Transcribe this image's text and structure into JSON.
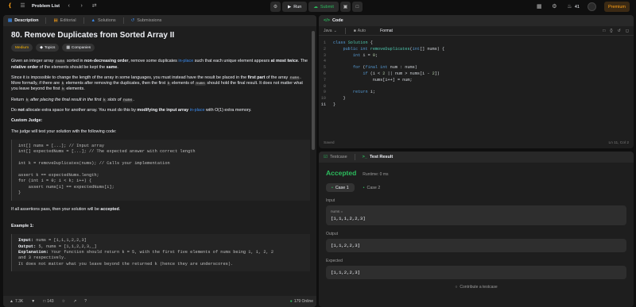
{
  "topbar": {
    "problem_list": "Problem List",
    "run": "Run",
    "submit": "Submit",
    "points": "41",
    "premium": "Premium"
  },
  "desc_tabs": [
    "Description",
    "Editorial",
    "Solutions",
    "Submissions"
  ],
  "problem": {
    "title": "80. Remove Duplicates from Sorted Array II",
    "tags": [
      "Medium",
      "Topics",
      "Companies"
    ],
    "p1_a": "Given an integer array ",
    "p1_b": "nums",
    "p1_c": " sorted in ",
    "p1_d": "non-decreasing order",
    "p1_e": ", remove some duplicates ",
    "p1_f": "in-place",
    "p1_g": " such that each unique element appears ",
    "p1_h": "at most twice",
    "p1_i": ". The ",
    "p1_j": "relative order",
    "p1_k": " of the elements should be kept the ",
    "p1_l": "same",
    "p1_m": ".",
    "p2_a": "Since it is impossible to change the length of the array in some languages, you must instead have the result be placed in the ",
    "p2_b": "first part",
    "p2_c": " of the array ",
    "p2_d": "nums",
    "p2_e": ". More formally, if there are ",
    "p2_f": "k",
    "p2_g": " elements after removing the duplicates, then the first ",
    "p2_h": "k",
    "p2_i": " elements of ",
    "p2_j": "nums",
    "p2_k": " should hold the final result. It does not matter what you leave beyond the first ",
    "p2_l": "k",
    "p2_m": " elements.",
    "p3_a": "Return ",
    "p3_b": "k",
    "p3_c": " after placing the final result in the first ",
    "p3_d": "k",
    "p3_e": " slots of ",
    "p3_f": "nums",
    "p3_g": ".",
    "p4_a": "Do ",
    "p4_b": "not",
    "p4_c": " allocate extra space for another array. You must do this by ",
    "p4_d": "modifying the input array",
    "p4_e": " in-place",
    "p4_f": " with O(1) extra memory.",
    "judge_title": "Custom Judge:",
    "judge_text": "The judge will test your solution with the following code:",
    "judge_code": "int[] nums = [...]; // Input array\nint[] expectedNums = [...]; // The expected answer with correct length\n\nint k = removeDuplicates(nums); // Calls your implementation\n\nassert k == expectedNums.length;\nfor (int i = 0; i < k; i++) {\n    assert nums[i] == expectedNums[i];\n}",
    "accept_a": "If all assertions pass, then your solution will be ",
    "accept_b": "accepted",
    "accept_c": ".",
    "example_title": "Example 1:",
    "ex_input_l": "Input:",
    "ex_input_v": " nums = [1,1,1,2,2,3]",
    "ex_output_l": "Output:",
    "ex_output_v": " 5, nums = [1,1,2,2,3,_]",
    "ex_expl_l": "Explanation:",
    "ex_expl_v": " Your function should return k = 5, with the first five elements of nums being 1, 1, 2, 2\nand 3 respectively.\nIt does not matter what you leave beyond the returned k (hence they are underscores)."
  },
  "bottom": {
    "likes": "7.3K",
    "comments": "143",
    "online": "179 Online"
  },
  "code_panel": {
    "title": "Code",
    "lang": "Java",
    "auto": "Auto",
    "format": "Format",
    "saved": "Saved",
    "cursor": "Ln 11, Col 2",
    "lines": [
      {
        "n": "1",
        "t": "class Solution {"
      },
      {
        "n": "2",
        "t": "    public int removeDuplicates(int[] nums) {"
      },
      {
        "n": "3",
        "t": "        int i = 0;"
      },
      {
        "n": "4",
        "t": ""
      },
      {
        "n": "5",
        "t": "        for (final int num : nums)"
      },
      {
        "n": "6",
        "t": "            if (i < 2 || num > nums[i - 2])"
      },
      {
        "n": "7",
        "t": "                nums[i++] = num;"
      },
      {
        "n": "8",
        "t": ""
      },
      {
        "n": "9",
        "t": "        return i;"
      },
      {
        "n": "10",
        "t": "    }"
      },
      {
        "n": "11",
        "t": "}"
      }
    ]
  },
  "test_panel": {
    "testcase": "Testcase",
    "result": "Test Result",
    "accepted": "Accepted",
    "runtime": "Runtime: 0 ms",
    "case1": "Case 1",
    "case2": "Case 2",
    "input_label": "Input",
    "var_label": "nums =",
    "input_val": "[1,1,1,2,2,3]",
    "output_label": "Output",
    "output_val": "[1,1,2,2,3]",
    "expected_label": "Expected",
    "expected_val": "[1,1,2,2,3]",
    "contribute": "Contribute a testcase"
  }
}
